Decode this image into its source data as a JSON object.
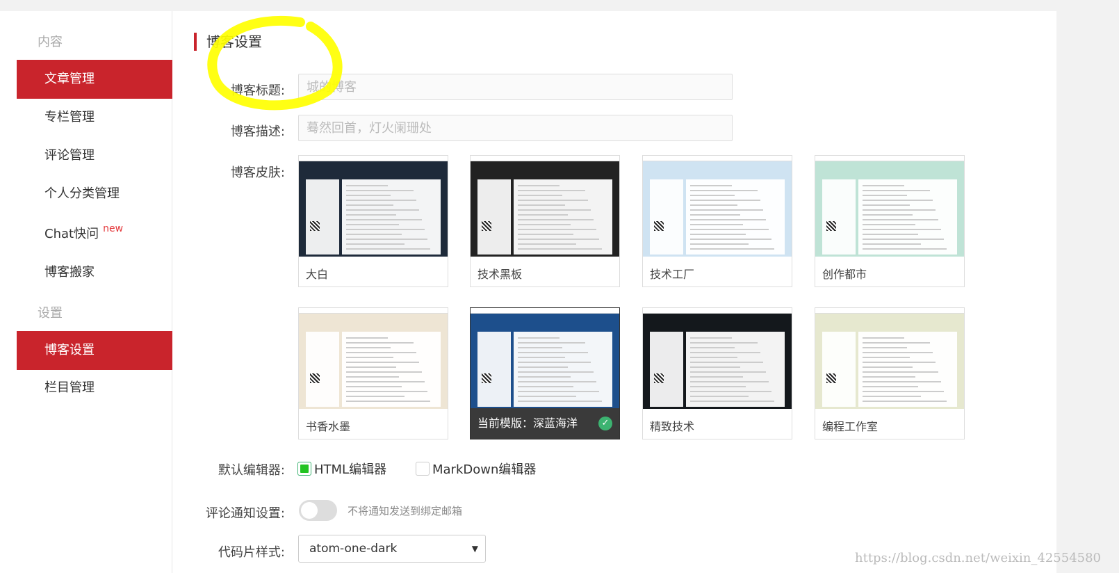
{
  "sidebar": {
    "section_content": "内容",
    "section_settings": "设置",
    "items": [
      {
        "label": "文章管理"
      },
      {
        "label": "专栏管理"
      },
      {
        "label": "评论管理"
      },
      {
        "label": "个人分类管理"
      },
      {
        "label": "Chat快问",
        "badge": "new"
      },
      {
        "label": "博客搬家"
      },
      {
        "label": "博客设置"
      },
      {
        "label": "栏目管理"
      }
    ]
  },
  "main": {
    "heading": "博客设置",
    "title_label": "博客标题:",
    "title_placeholder": "城的博客",
    "desc_label": "博客描述:",
    "desc_placeholder": "蓦然回首，灯火阑珊处",
    "skin_label": "博客皮肤:",
    "skins": [
      {
        "name": "大白",
        "theme": "#1e2a3a"
      },
      {
        "name": "技术黑板",
        "theme": "#222222"
      },
      {
        "name": "技术工厂",
        "theme": "#cfe3f2"
      },
      {
        "name": "创作都市",
        "theme": "#bfe3d6"
      },
      {
        "name": "书香水墨",
        "theme": "#eee5d4"
      },
      {
        "name": "深蓝海洋",
        "theme": "#1d4f8c"
      },
      {
        "name": "精致技术",
        "theme": "#14181c"
      },
      {
        "name": "编程工作室",
        "theme": "#e6e8cf"
      }
    ],
    "current_template_text": "当前模版：深蓝海洋",
    "editor_label": "默认编辑器:",
    "editor_html": "HTML编辑器",
    "editor_markdown": "MarkDown编辑器",
    "comment_label": "评论通知设置:",
    "comment_hint": "不将通知发送到绑定邮箱",
    "code_label": "代码片样式:",
    "code_value": "atom-one-dark"
  },
  "watermark": "https://blog.csdn.net/weixin_42554580",
  "colors": {
    "accent": "#c9242c",
    "check": "#3cb371",
    "highlight": "#ffff00"
  }
}
